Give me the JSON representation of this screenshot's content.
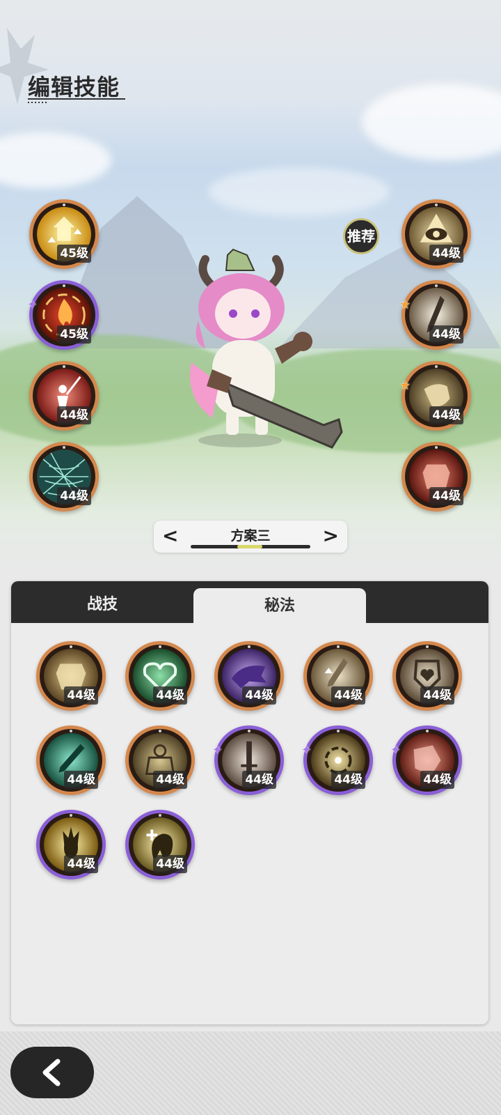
{
  "header": {
    "title": "编辑技能"
  },
  "recommend_label": "推荐",
  "left_skills": [
    {
      "icon": "golden-arrows-icon",
      "level": "45级",
      "frame": "orange"
    },
    {
      "icon": "flame-swirl-icon",
      "level": "45级",
      "frame": "purple",
      "star": "purple"
    },
    {
      "icon": "warrior-slash-icon",
      "level": "44级",
      "frame": "orange"
    },
    {
      "icon": "cobweb-icon",
      "level": "44级",
      "frame": "orange"
    }
  ],
  "right_skills": [
    {
      "icon": "eye-icon",
      "level": "44级",
      "frame": "orange"
    },
    {
      "icon": "blade-icon",
      "level": "44级",
      "frame": "orange",
      "star": "gold"
    },
    {
      "icon": "hand-strike-icon",
      "level": "44级",
      "frame": "orange",
      "star": "gold"
    },
    {
      "icon": "armor-icon",
      "level": "44级",
      "frame": "orange"
    }
  ],
  "plan": {
    "label": "方案三",
    "prev_arrow": "<",
    "next_arrow": ">"
  },
  "tabs": {
    "combat": "战技",
    "secret": "秘法"
  },
  "grid_skills": [
    {
      "icon": "golden-armor-icon",
      "level": "44级",
      "frame": "orange"
    },
    {
      "icon": "heart-heal-icon",
      "level": "44级",
      "frame": "orange"
    },
    {
      "icon": "shadow-beast-icon",
      "level": "44级",
      "frame": "orange"
    },
    {
      "icon": "sword-up-icon",
      "level": "44级",
      "frame": "orange"
    },
    {
      "icon": "shield-heart-icon",
      "level": "44级",
      "frame": "orange"
    },
    {
      "icon": "wind-sword-icon",
      "level": "44级",
      "frame": "orange"
    },
    {
      "icon": "golem-icon",
      "level": "44级",
      "frame": "orange"
    },
    {
      "icon": "sword-pillar-icon",
      "level": "44级",
      "frame": "purple",
      "star": "purple"
    },
    {
      "icon": "target-vortex-icon",
      "level": "44级",
      "frame": "purple",
      "star": "purple"
    },
    {
      "icon": "crimson-armor-icon",
      "level": "44级",
      "frame": "purple",
      "star": "purple"
    },
    {
      "icon": "flame-spirit-icon",
      "level": "44级",
      "frame": "purple"
    },
    {
      "icon": "heal-creature-icon",
      "level": "44级",
      "frame": "purple"
    }
  ],
  "colors": {
    "orange_frame": "#d4884d",
    "purple_frame": "#8a5fd6",
    "gold_star": "#f2a43a"
  }
}
